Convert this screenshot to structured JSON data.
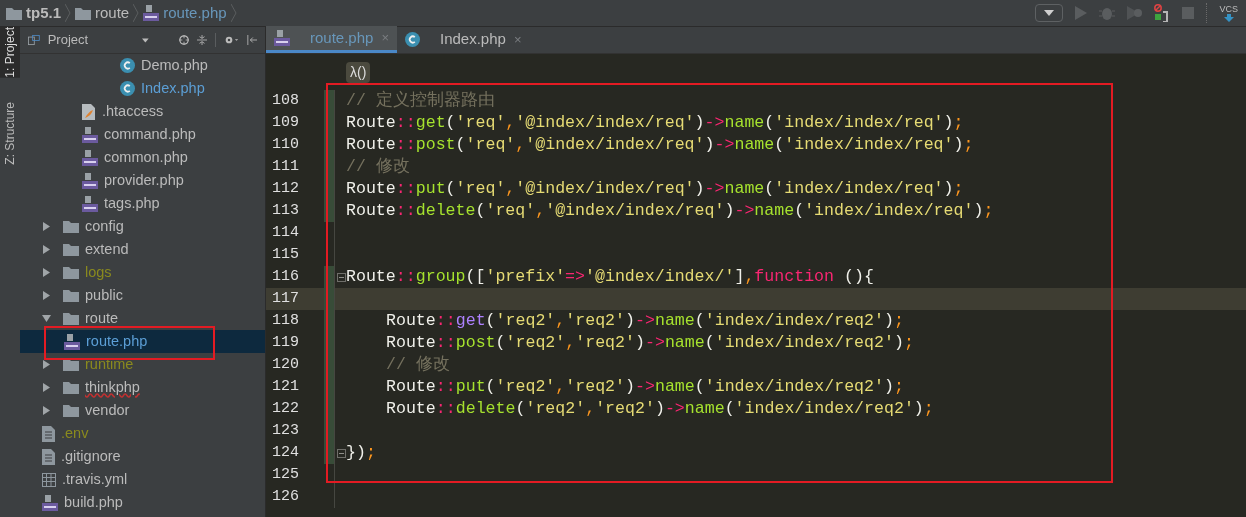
{
  "breadcrumbs": [
    {
      "kind": "folder",
      "label": "tp5.1",
      "bold": true
    },
    {
      "kind": "folder",
      "label": "route",
      "bold": false
    },
    {
      "kind": "php",
      "label": "route.php",
      "bold": false
    }
  ],
  "toolbar": {
    "vcs_label": "VCS"
  },
  "side_tabs": [
    {
      "label": "1: Project",
      "selected": true
    },
    {
      "label": "Z: Structure",
      "selected": false
    }
  ],
  "project_panel": {
    "title": "Project"
  },
  "tree": [
    {
      "kind": "class",
      "label": "Demo.php",
      "ignored": false,
      "selected": false,
      "misspelled": false,
      "link": false
    },
    {
      "kind": "class",
      "label": "Index.php",
      "ignored": false,
      "selected": false,
      "misspelled": false,
      "link": true
    },
    {
      "kind": "htaccess",
      "label": ".htaccess",
      "ignored": false,
      "selected": false,
      "misspelled": false,
      "link": false
    },
    {
      "kind": "php",
      "label": "command.php",
      "ignored": false,
      "selected": false,
      "misspelled": false,
      "link": false
    },
    {
      "kind": "php",
      "label": "common.php",
      "ignored": false,
      "selected": false,
      "misspelled": false,
      "link": false
    },
    {
      "kind": "php",
      "label": "provider.php",
      "ignored": false,
      "selected": false,
      "misspelled": false,
      "link": false
    },
    {
      "kind": "php",
      "label": "tags.php",
      "ignored": false,
      "selected": false,
      "misspelled": false,
      "link": false
    },
    {
      "kind": "folder",
      "label": "config",
      "expanded": false,
      "ignored": false,
      "selected": false,
      "misspelled": false,
      "link": false
    },
    {
      "kind": "folder",
      "label": "extend",
      "expanded": false,
      "ignored": false,
      "selected": false,
      "misspelled": false,
      "link": false
    },
    {
      "kind": "folder",
      "label": "logs",
      "expanded": false,
      "ignored": true,
      "selected": false,
      "misspelled": false
    },
    {
      "kind": "folder",
      "label": "public",
      "expanded": false,
      "ignored": false,
      "selected": false,
      "misspelled": false,
      "link": false
    },
    {
      "kind": "folder",
      "label": "route",
      "expanded": true,
      "ignored": false,
      "selected": false,
      "misspelled": false,
      "link": false,
      "children": [
        {
          "kind": "php",
          "label": "route.php",
          "ignored": false,
          "selected": true,
          "misspelled": false,
          "link": true
        }
      ]
    },
    {
      "kind": "folder",
      "label": "runtime",
      "expanded": false,
      "ignored": true,
      "selected": false,
      "misspelled": false
    },
    {
      "kind": "folder",
      "label": "thinkphp",
      "expanded": false,
      "ignored": false,
      "selected": false,
      "misspelled": true,
      "link": false
    },
    {
      "kind": "folder",
      "label": "vendor",
      "expanded": false,
      "ignored": false,
      "selected": false,
      "misspelled": false,
      "link": false
    },
    {
      "kind": "text",
      "label": ".env",
      "ignored": true,
      "selected": false,
      "misspelled": false
    },
    {
      "kind": "text",
      "label": ".gitignore",
      "ignored": false,
      "selected": false,
      "misspelled": false,
      "link": false
    },
    {
      "kind": "table",
      "label": ".travis.yml",
      "ignored": false,
      "selected": false,
      "misspelled": false,
      "link": false
    },
    {
      "kind": "php",
      "label": "build.php",
      "ignored": false,
      "selected": false,
      "misspelled": false,
      "link": false
    }
  ],
  "tabs": [
    {
      "kind": "php",
      "label": "route.php",
      "selected": true,
      "close": "×"
    },
    {
      "kind": "class",
      "label": "Index.php",
      "selected": false,
      "close": "×"
    }
  ],
  "editor": {
    "scope_chip": "λ()",
    "lines": [
      {
        "number": "108",
        "changed": true,
        "current": false,
        "fold": false,
        "tokens": [
          {
            "kind": "comment",
            "text": "// 定义控制器路由"
          }
        ]
      },
      {
        "number": "109",
        "changed": true,
        "current": false,
        "fold": false,
        "tokens": [
          {
            "kind": "class",
            "text": "Route"
          },
          {
            "kind": "op",
            "text": "::"
          },
          {
            "kind": "method",
            "text": "get"
          },
          {
            "kind": "plain",
            "text": "("
          },
          {
            "kind": "string",
            "text": "'req'"
          },
          {
            "kind": "punct",
            "text": ","
          },
          {
            "kind": "string",
            "text": "'@index/index/req'"
          },
          {
            "kind": "plain",
            "text": ")"
          },
          {
            "kind": "op",
            "text": "->"
          },
          {
            "kind": "method",
            "text": "name"
          },
          {
            "kind": "plain",
            "text": "("
          },
          {
            "kind": "string",
            "text": "'index/index/req'"
          },
          {
            "kind": "plain",
            "text": ")"
          },
          {
            "kind": "punct",
            "text": ";"
          }
        ]
      },
      {
        "number": "110",
        "changed": true,
        "current": false,
        "fold": false,
        "tokens": [
          {
            "kind": "class",
            "text": "Route"
          },
          {
            "kind": "op",
            "text": "::"
          },
          {
            "kind": "method",
            "text": "post"
          },
          {
            "kind": "plain",
            "text": "("
          },
          {
            "kind": "string",
            "text": "'req'"
          },
          {
            "kind": "punct",
            "text": ","
          },
          {
            "kind": "string",
            "text": "'@index/index/req'"
          },
          {
            "kind": "plain",
            "text": ")"
          },
          {
            "kind": "op",
            "text": "->"
          },
          {
            "kind": "method",
            "text": "name"
          },
          {
            "kind": "plain",
            "text": "("
          },
          {
            "kind": "string",
            "text": "'index/index/req'"
          },
          {
            "kind": "plain",
            "text": ")"
          },
          {
            "kind": "punct",
            "text": ";"
          }
        ]
      },
      {
        "number": "111",
        "changed": true,
        "current": false,
        "fold": false,
        "tokens": [
          {
            "kind": "comment",
            "text": "// 修改"
          }
        ]
      },
      {
        "number": "112",
        "changed": true,
        "current": false,
        "fold": false,
        "tokens": [
          {
            "kind": "class",
            "text": "Route"
          },
          {
            "kind": "op",
            "text": "::"
          },
          {
            "kind": "method",
            "text": "put"
          },
          {
            "kind": "plain",
            "text": "("
          },
          {
            "kind": "string",
            "text": "'req'"
          },
          {
            "kind": "punct",
            "text": ","
          },
          {
            "kind": "string",
            "text": "'@index/index/req'"
          },
          {
            "kind": "plain",
            "text": ")"
          },
          {
            "kind": "op",
            "text": "->"
          },
          {
            "kind": "method",
            "text": "name"
          },
          {
            "kind": "plain",
            "text": "("
          },
          {
            "kind": "string",
            "text": "'index/index/req'"
          },
          {
            "kind": "plain",
            "text": ")"
          },
          {
            "kind": "punct",
            "text": ";"
          }
        ]
      },
      {
        "number": "113",
        "changed": true,
        "current": false,
        "fold": false,
        "tokens": [
          {
            "kind": "class",
            "text": "Route"
          },
          {
            "kind": "op",
            "text": "::"
          },
          {
            "kind": "method",
            "text": "delete"
          },
          {
            "kind": "plain",
            "text": "("
          },
          {
            "kind": "string",
            "text": "'req'"
          },
          {
            "kind": "punct",
            "text": ","
          },
          {
            "kind": "string",
            "text": "'@index/index/req'"
          },
          {
            "kind": "plain",
            "text": ")"
          },
          {
            "kind": "op",
            "text": "->"
          },
          {
            "kind": "method",
            "text": "name"
          },
          {
            "kind": "plain",
            "text": "("
          },
          {
            "kind": "string",
            "text": "'index/index/req'"
          },
          {
            "kind": "plain",
            "text": ")"
          },
          {
            "kind": "punct",
            "text": ";"
          }
        ]
      },
      {
        "number": "114",
        "changed": false,
        "current": false,
        "fold": false
      },
      {
        "number": "115",
        "changed": false,
        "current": false,
        "fold": false
      },
      {
        "number": "116",
        "changed": true,
        "current": false,
        "fold": true,
        "tokens": [
          {
            "kind": "class",
            "text": "Route"
          },
          {
            "kind": "op",
            "text": "::"
          },
          {
            "kind": "method",
            "text": "group"
          },
          {
            "kind": "plain",
            "text": "(["
          },
          {
            "kind": "string",
            "text": "'prefix'"
          },
          {
            "kind": "op",
            "text": "=>"
          },
          {
            "kind": "string",
            "text": "'@index/index/'"
          },
          {
            "kind": "plain",
            "text": "]"
          },
          {
            "kind": "punct",
            "text": ","
          },
          {
            "kind": "keyword",
            "text": "function"
          },
          {
            "kind": "plain",
            "text": " (){"
          }
        ]
      },
      {
        "number": "117",
        "changed": true,
        "current": true,
        "fold": false
      },
      {
        "number": "118",
        "changed": true,
        "current": false,
        "fold": false,
        "indented": true,
        "tokens": [
          {
            "kind": "class",
            "text": "Route"
          },
          {
            "kind": "op",
            "text": "::"
          },
          {
            "kind": "method_alt",
            "text": "get"
          },
          {
            "kind": "plain",
            "text": "("
          },
          {
            "kind": "string",
            "text": "'req2'"
          },
          {
            "kind": "punct",
            "text": ","
          },
          {
            "kind": "string",
            "text": "'req2'"
          },
          {
            "kind": "plain",
            "text": ")"
          },
          {
            "kind": "op",
            "text": "->"
          },
          {
            "kind": "method",
            "text": "name"
          },
          {
            "kind": "plain",
            "text": "("
          },
          {
            "kind": "string",
            "text": "'index/index/req2'"
          },
          {
            "kind": "plain",
            "text": ")"
          },
          {
            "kind": "punct",
            "text": ";"
          }
        ]
      },
      {
        "number": "119",
        "changed": true,
        "current": false,
        "fold": false,
        "indented": true,
        "tokens": [
          {
            "kind": "class",
            "text": "Route"
          },
          {
            "kind": "op",
            "text": "::"
          },
          {
            "kind": "method",
            "text": "post"
          },
          {
            "kind": "plain",
            "text": "("
          },
          {
            "kind": "string",
            "text": "'req2'"
          },
          {
            "kind": "punct",
            "text": ","
          },
          {
            "kind": "string",
            "text": "'req2'"
          },
          {
            "kind": "plain",
            "text": ")"
          },
          {
            "kind": "op",
            "text": "->"
          },
          {
            "kind": "method",
            "text": "name"
          },
          {
            "kind": "plain",
            "text": "("
          },
          {
            "kind": "string",
            "text": "'index/index/req2'"
          },
          {
            "kind": "plain",
            "text": ")"
          },
          {
            "kind": "punct",
            "text": ";"
          }
        ]
      },
      {
        "number": "120",
        "changed": true,
        "current": false,
        "fold": false,
        "indented": true,
        "tokens": [
          {
            "kind": "comment",
            "text": "// 修改"
          }
        ]
      },
      {
        "number": "121",
        "changed": true,
        "current": false,
        "fold": false,
        "indented": true,
        "tokens": [
          {
            "kind": "class",
            "text": "Route"
          },
          {
            "kind": "op",
            "text": "::"
          },
          {
            "kind": "method",
            "text": "put"
          },
          {
            "kind": "plain",
            "text": "("
          },
          {
            "kind": "string",
            "text": "'req2'"
          },
          {
            "kind": "punct",
            "text": ","
          },
          {
            "kind": "string",
            "text": "'req2'"
          },
          {
            "kind": "plain",
            "text": ")"
          },
          {
            "kind": "op",
            "text": "->"
          },
          {
            "kind": "method",
            "text": "name"
          },
          {
            "kind": "plain",
            "text": "("
          },
          {
            "kind": "string",
            "text": "'index/index/req2'"
          },
          {
            "kind": "plain",
            "text": ")"
          },
          {
            "kind": "punct",
            "text": ";"
          }
        ]
      },
      {
        "number": "122",
        "changed": true,
        "current": false,
        "fold": false,
        "indented": true,
        "tokens": [
          {
            "kind": "class",
            "text": "Route"
          },
          {
            "kind": "op",
            "text": "::"
          },
          {
            "kind": "method",
            "text": "delete"
          },
          {
            "kind": "plain",
            "text": "("
          },
          {
            "kind": "string",
            "text": "'req2'"
          },
          {
            "kind": "punct",
            "text": ","
          },
          {
            "kind": "string",
            "text": "'req2'"
          },
          {
            "kind": "plain",
            "text": ")"
          },
          {
            "kind": "op",
            "text": "->"
          },
          {
            "kind": "method",
            "text": "name"
          },
          {
            "kind": "plain",
            "text": "("
          },
          {
            "kind": "string",
            "text": "'index/index/req2'"
          },
          {
            "kind": "plain",
            "text": ")"
          },
          {
            "kind": "punct",
            "text": ";"
          }
        ]
      },
      {
        "number": "123",
        "changed": true,
        "current": false,
        "fold": false
      },
      {
        "number": "124",
        "changed": true,
        "current": false,
        "fold": true,
        "tokens": [
          {
            "kind": "plain",
            "text": "})"
          },
          {
            "kind": "punct",
            "text": ";"
          }
        ]
      },
      {
        "number": "125",
        "changed": false,
        "current": false,
        "fold": false
      },
      {
        "number": "126",
        "changed": false,
        "current": false,
        "fold": false
      }
    ]
  }
}
